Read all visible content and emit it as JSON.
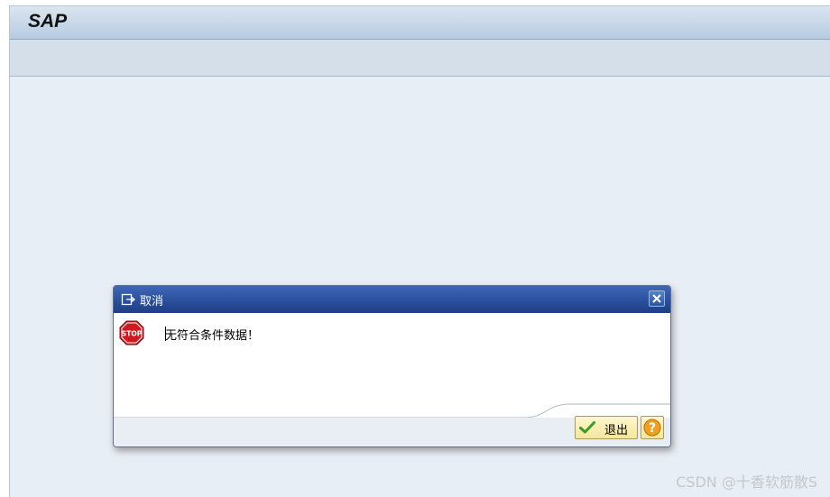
{
  "app": {
    "logo": "SAP"
  },
  "dialog": {
    "title": "取消",
    "message": "无符合条件数据！",
    "exit_button_label": "退出",
    "title_icon": "exit-doc-icon",
    "message_icon": "stop-sign-icon",
    "help_icon": "help-question-icon",
    "close_icon": "close-x-icon"
  },
  "watermark": "CSDN @十香软筋散S",
  "colors": {
    "dialog_title_bg": "#2a4f9d",
    "button_bg": "#f5e69a",
    "window_bg": "#e8eef5",
    "stop_red": "#d0191e"
  }
}
